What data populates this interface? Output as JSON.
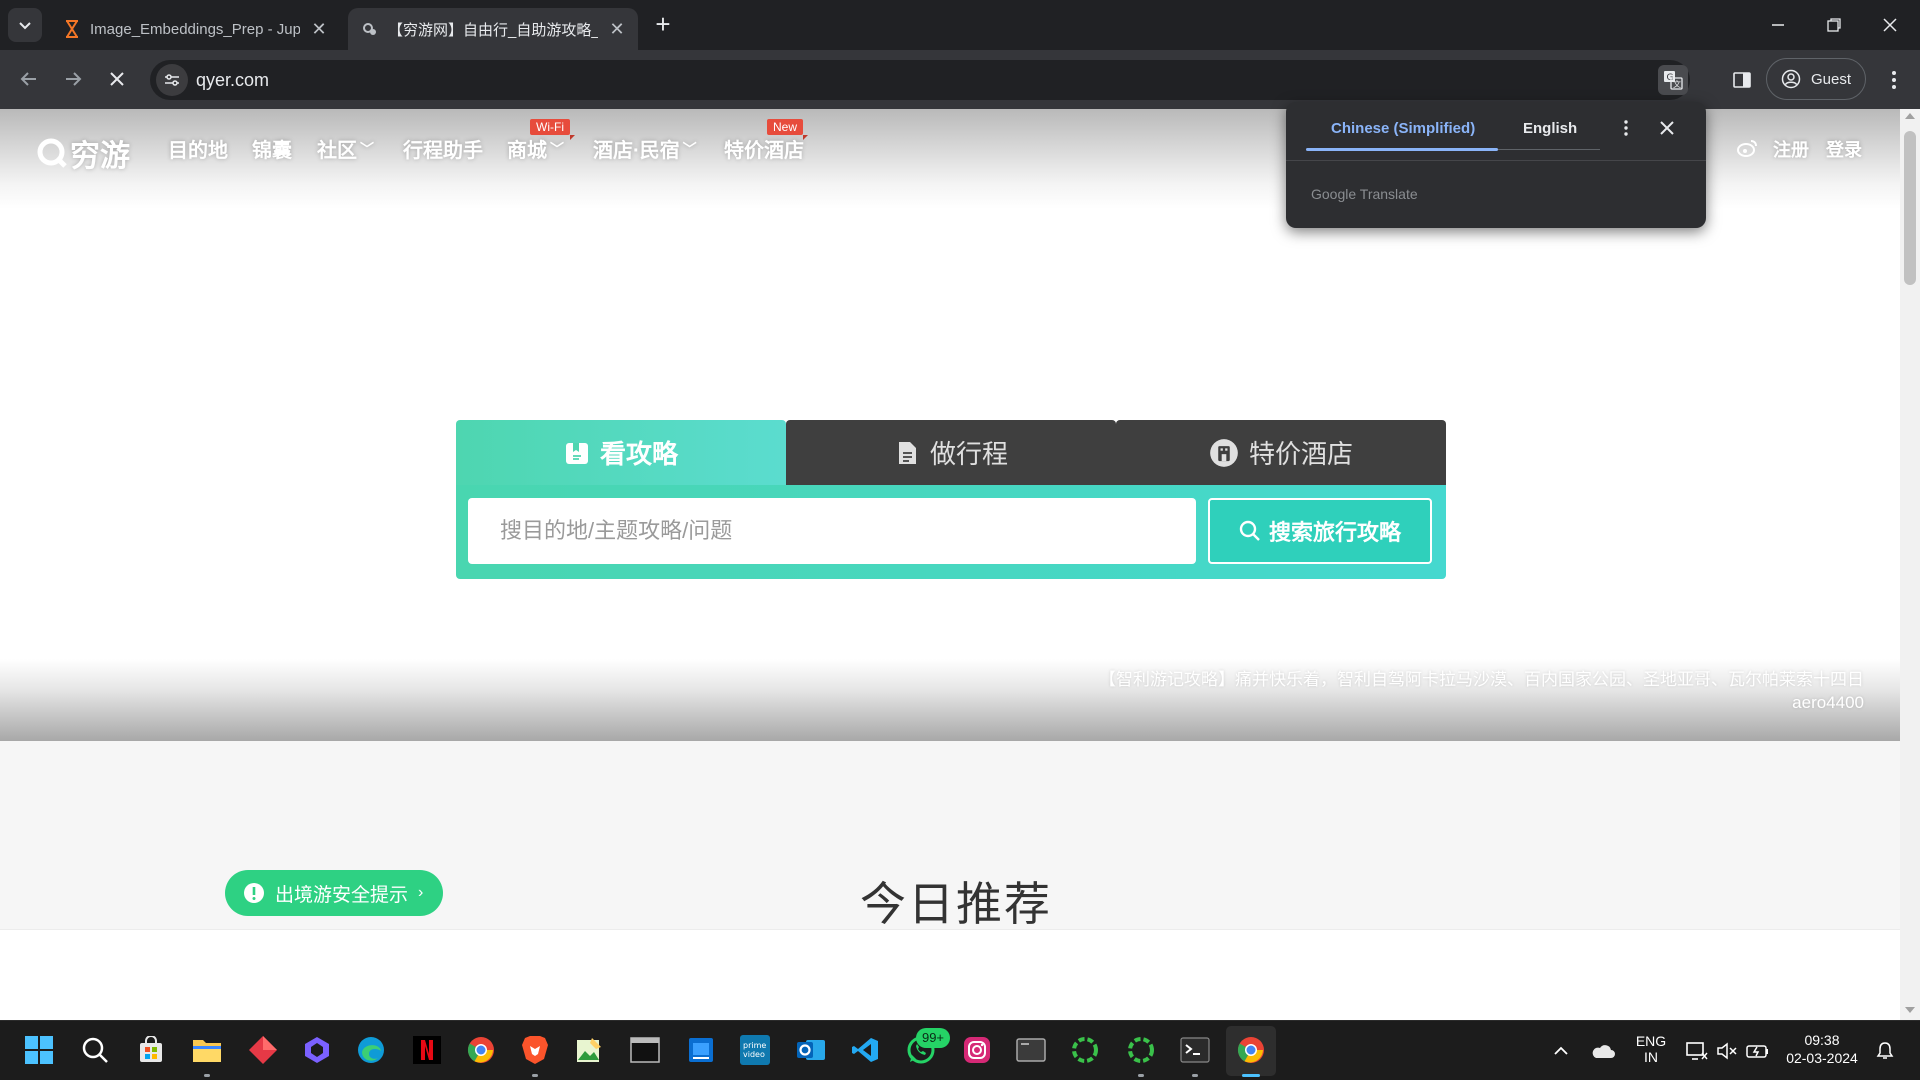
{
  "browser": {
    "tabs": [
      {
        "title": "Image_Embeddings_Prep - Jupyter",
        "active": false
      },
      {
        "title": "【穷游网】自由行_自助游攻略_旅行社区",
        "active": true
      }
    ],
    "address": "qyer.com",
    "profile_label": "Guest"
  },
  "translate_popup": {
    "source_lang": "Chinese (Simplified)",
    "target_lang": "English",
    "provider": "Google Translate"
  },
  "site": {
    "logo_text": "穷游",
    "nav": [
      {
        "label": "目的地"
      },
      {
        "label": "锦囊"
      },
      {
        "label": "社区"
      },
      {
        "label": "行程助手"
      },
      {
        "label": "商城",
        "badge": "Wi-Fi"
      },
      {
        "label": "酒店·民宿"
      },
      {
        "label": "特价酒店",
        "badge": "New"
      }
    ],
    "auth": {
      "register": "注册",
      "login": "登录"
    }
  },
  "search": {
    "tabs": [
      "看攻略",
      "做行程",
      "特价酒店"
    ],
    "active_tab": 0,
    "placeholder": "搜目的地/主题攻略/问题",
    "button_label": "搜索旅行攻略"
  },
  "hero_credit": {
    "caption": "【智利游记攻略】痛并快乐着，智利自驾阿卡拉马沙漠、百内国家公园、圣地亚哥、瓦尔帕莱索十四日",
    "author": "aero4400"
  },
  "safety_tip": "出境游安全提示",
  "today_title": "今日推荐",
  "taskbar": {
    "whatsapp_badge": "99+",
    "lang_top": "ENG",
    "lang_bottom": "IN",
    "time": "09:38",
    "date": "02-03-2024"
  },
  "colors": {
    "accent_teal": "#4ed6b0",
    "safety_green": "#2ed183",
    "dark_tab": "#3f3f3f",
    "translate_accent": "#8ab4f8"
  }
}
